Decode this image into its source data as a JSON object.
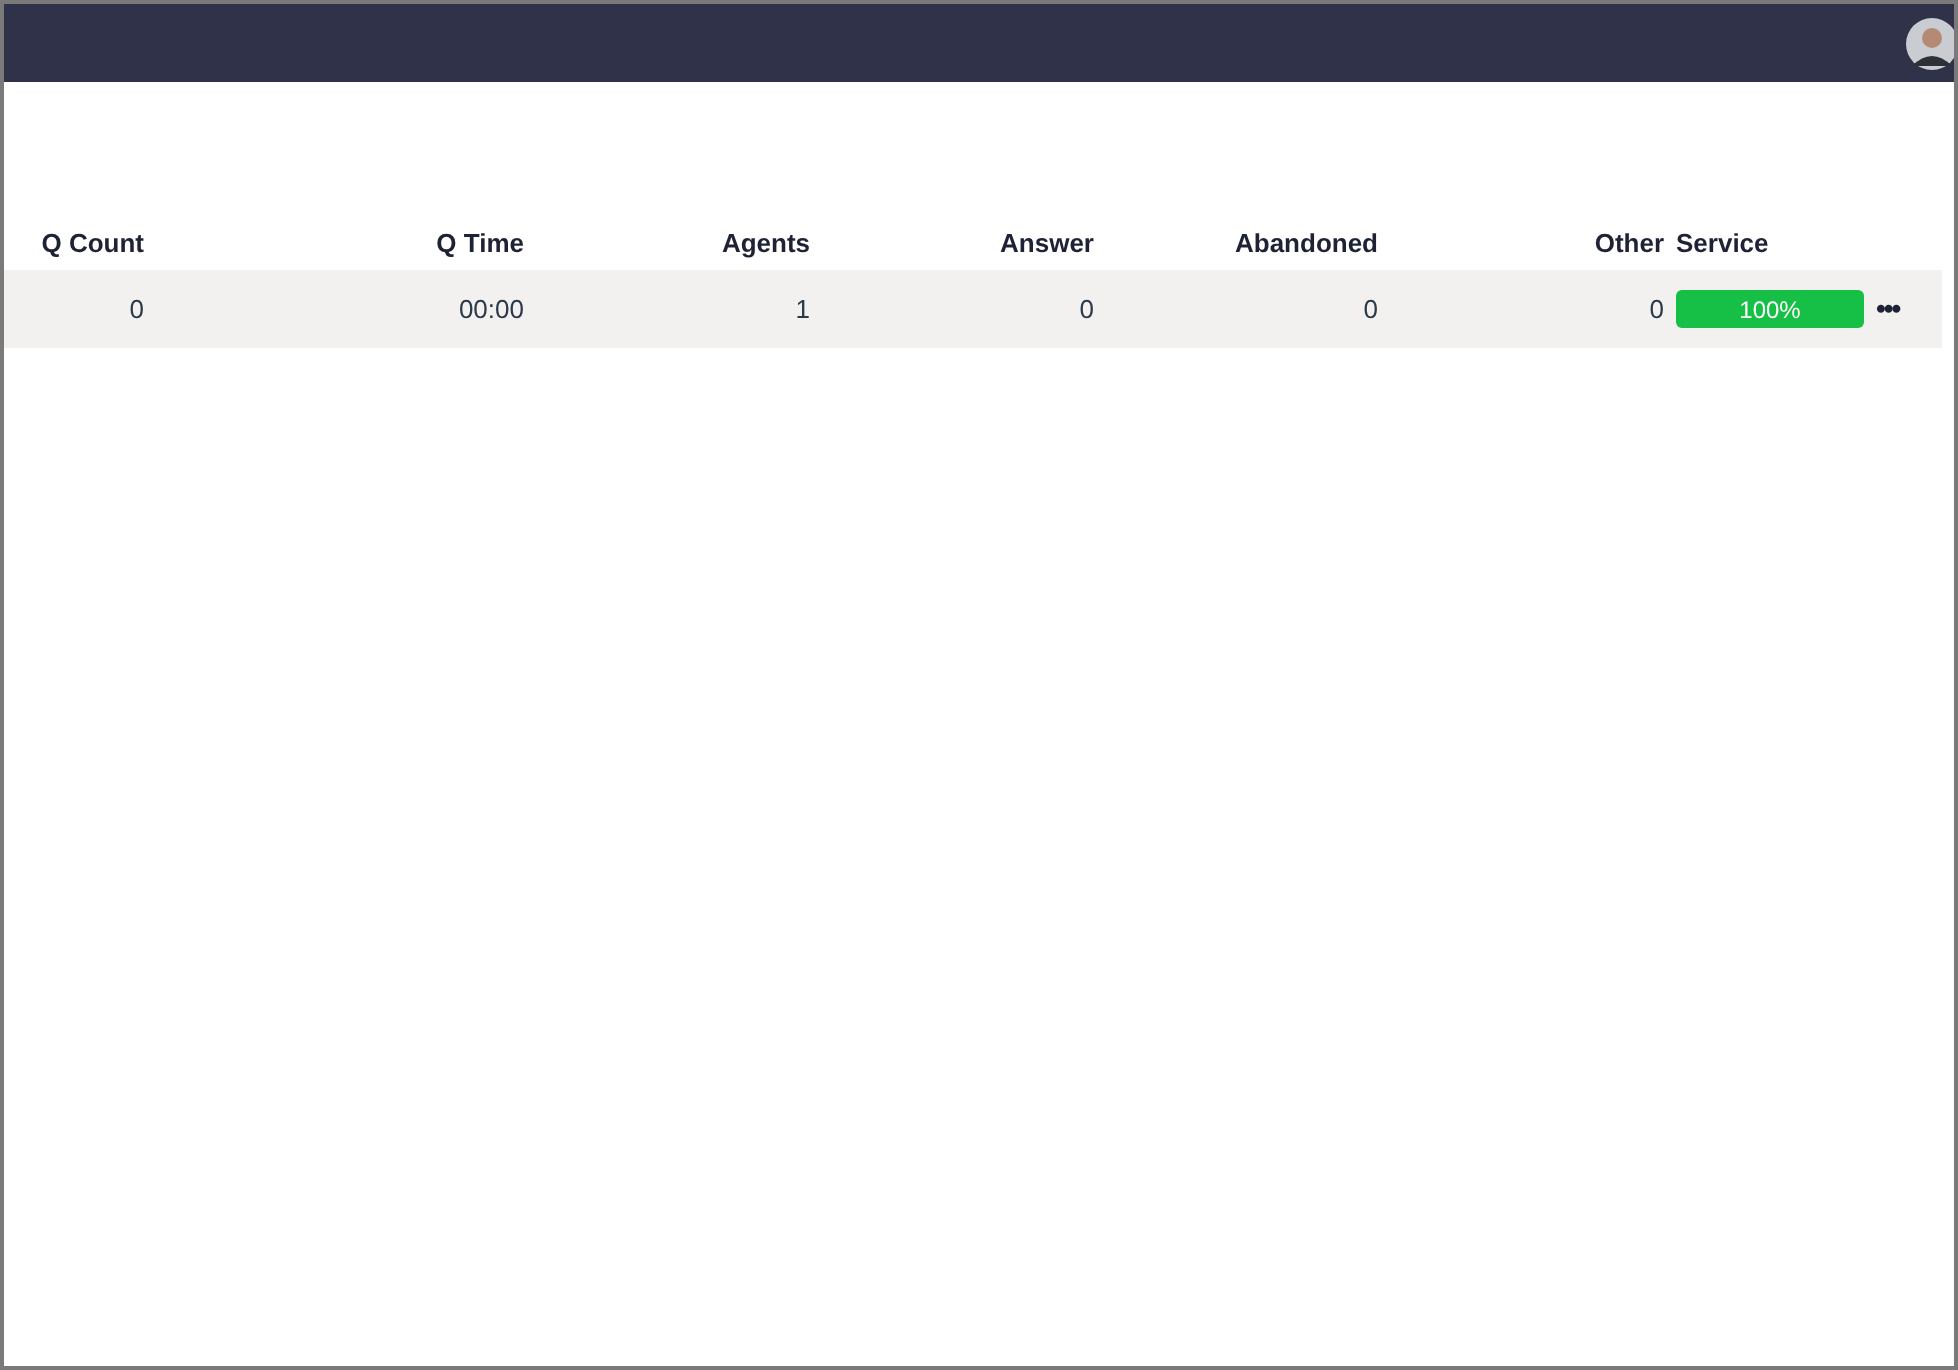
{
  "table": {
    "columns": [
      "Q Count",
      "Q Time",
      "Agents",
      "Answer",
      "Abandoned",
      "Other",
      "Service"
    ],
    "rows": [
      {
        "cells": [
          "0",
          "00:00",
          "1",
          "0",
          "0",
          "0"
        ],
        "service": {
          "text": "100%",
          "level": 1
        },
        "menu": "•••"
      }
    ]
  }
}
